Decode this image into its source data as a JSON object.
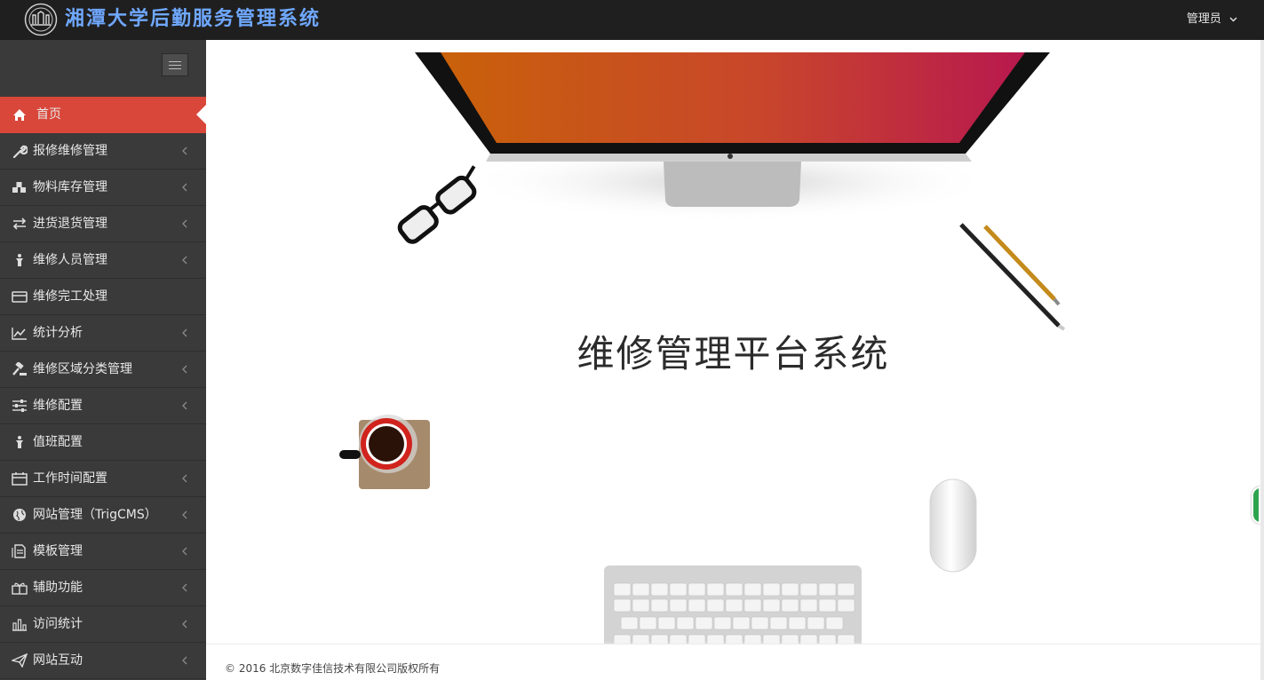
{
  "header": {
    "app_title": "湘潭大学后勤服务管理系统",
    "user_label": "管理员"
  },
  "sidebar": {
    "items": [
      {
        "label": "首页",
        "icon": "home-icon",
        "active": true,
        "has_arrow": false
      },
      {
        "label": "报修维修管理",
        "icon": "wrench-icon",
        "active": false,
        "has_arrow": true
      },
      {
        "label": "物料库存管理",
        "icon": "cubes-icon",
        "active": false,
        "has_arrow": true
      },
      {
        "label": "进货退货管理",
        "icon": "exchange-icon",
        "active": false,
        "has_arrow": true
      },
      {
        "label": "维修人员管理",
        "icon": "worker-icon",
        "active": false,
        "has_arrow": true
      },
      {
        "label": "维修完工处理",
        "icon": "card-icon",
        "active": false,
        "has_arrow": false
      },
      {
        "label": "统计分析",
        "icon": "line-chart-icon",
        "active": false,
        "has_arrow": true
      },
      {
        "label": "维修区域分类管理",
        "icon": "gavel-icon",
        "active": false,
        "has_arrow": true
      },
      {
        "label": "维修配置",
        "icon": "sliders-icon",
        "active": false,
        "has_arrow": true
      },
      {
        "label": "值班配置",
        "icon": "worker-icon",
        "active": false,
        "has_arrow": false
      },
      {
        "label": "工作时间配置",
        "icon": "calendar-icon",
        "active": false,
        "has_arrow": true
      },
      {
        "label": "网站管理（TrigCMS）",
        "icon": "globe-icon",
        "active": false,
        "has_arrow": true
      },
      {
        "label": "模板管理",
        "icon": "file-icon",
        "active": false,
        "has_arrow": true
      },
      {
        "label": "辅助功能",
        "icon": "gift-icon",
        "active": false,
        "has_arrow": true
      },
      {
        "label": "访问统计",
        "icon": "bar-chart-icon",
        "active": false,
        "has_arrow": true
      },
      {
        "label": "网站互动",
        "icon": "paper-plane-icon",
        "active": false,
        "has_arrow": true
      }
    ]
  },
  "main": {
    "hero_title": "维修管理平台系统"
  },
  "footer": {
    "copyright": "© 2016 北京数字佳信技术有限公司版权所有"
  },
  "colors": {
    "topbar": "#1f1f1f",
    "sidebar": "#3a3a3a",
    "active_item": "#d9473a",
    "title_blue": "#6fa8ff"
  }
}
